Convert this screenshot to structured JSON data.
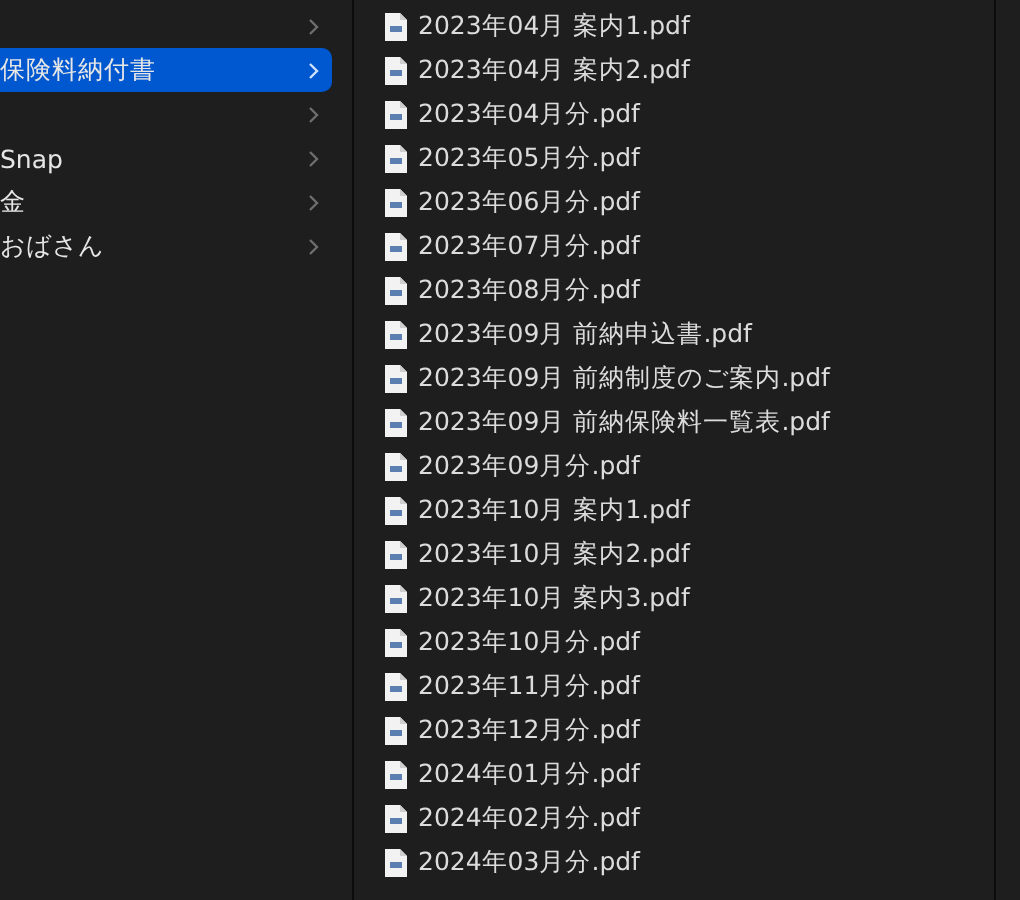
{
  "folders": [
    {
      "selected": false
    },
    {
      "label": "保険料納付書",
      "selected": true
    },
    {
      "selected": false
    },
    {
      "label": "Snap",
      "selected": false
    },
    {
      "label": "金",
      "selected": false
    },
    {
      "label": "おばさん",
      "selected": false
    }
  ],
  "files": [
    "2023年04月 案内1.pdf",
    "2023年04月 案内2.pdf",
    "2023年04月分.pdf",
    "2023年05月分.pdf",
    "2023年06月分.pdf",
    "2023年07月分.pdf",
    "2023年08月分.pdf",
    "2023年09月 前納申込書.pdf",
    "2023年09月 前納制度のご案内.pdf",
    "2023年09月 前納保険料一覧表.pdf",
    "2023年09月分.pdf",
    "2023年10月 案内1.pdf",
    "2023年10月 案内2.pdf",
    "2023年10月 案内3.pdf",
    "2023年10月分.pdf",
    "2023年11月分.pdf",
    "2023年12月分.pdf",
    "2024年01月分.pdf",
    "2024年02月分.pdf",
    "2024年03月分.pdf"
  ]
}
